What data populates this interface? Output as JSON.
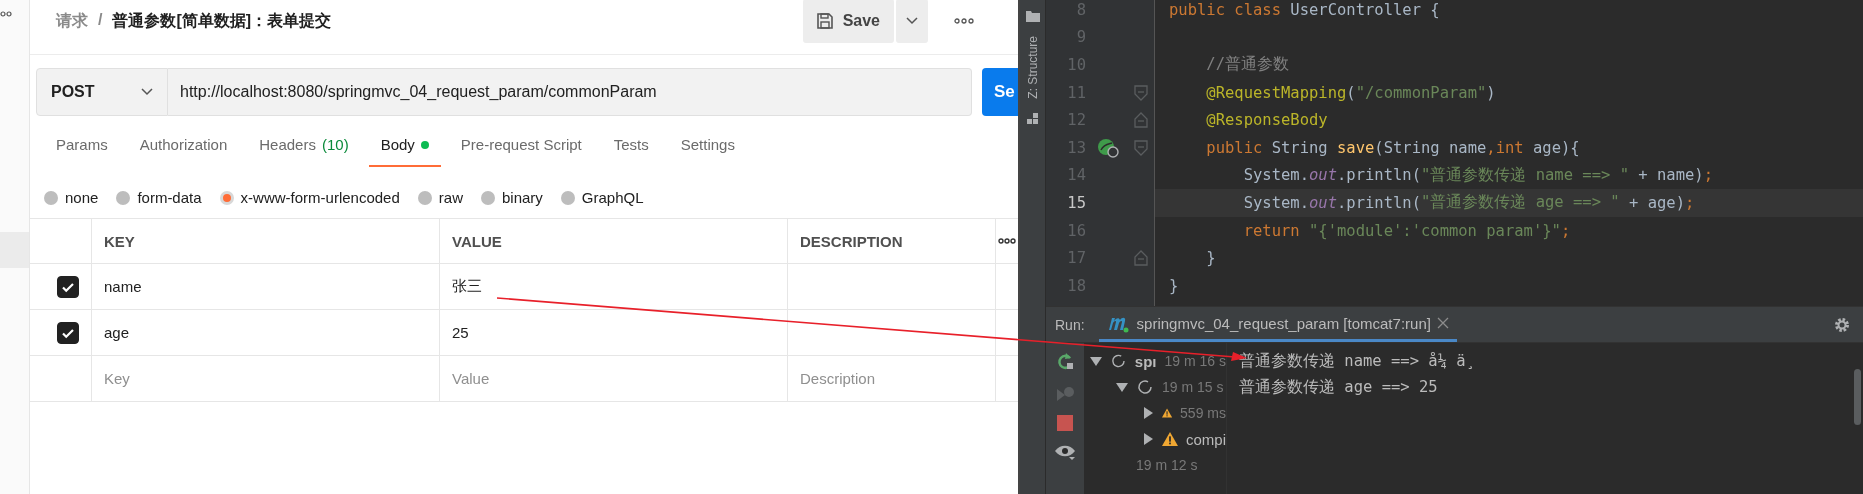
{
  "postman": {
    "breadcrumb": {
      "parent": "请求",
      "separator": "/",
      "title": "普通参数[简单数据]：表单提交"
    },
    "save_button": "Save",
    "request": {
      "method": "POST",
      "url": "http://localhost:8080/springmvc_04_request_param/commonParam",
      "send": "Se"
    },
    "tabs": [
      {
        "label": "Params",
        "selected": false
      },
      {
        "label": "Authorization",
        "selected": false
      },
      {
        "label": "Headers",
        "count": "(10)",
        "selected": false
      },
      {
        "label": "Body",
        "dot": true,
        "selected": true
      },
      {
        "label": "Pre-request Script",
        "selected": false
      },
      {
        "label": "Tests",
        "selected": false
      },
      {
        "label": "Settings",
        "selected": false
      }
    ],
    "body_types": [
      {
        "label": "none",
        "selected": false
      },
      {
        "label": "form-data",
        "selected": false
      },
      {
        "label": "x-www-form-urlencoded",
        "selected": true
      },
      {
        "label": "raw",
        "selected": false
      },
      {
        "label": "binary",
        "selected": false
      },
      {
        "label": "GraphQL",
        "selected": false
      }
    ],
    "table": {
      "columns": [
        "KEY",
        "VALUE",
        "DESCRIPTION"
      ],
      "rows": [
        {
          "checked": true,
          "key": "name",
          "value": "张三"
        },
        {
          "checked": true,
          "key": "age",
          "value": "25"
        }
      ],
      "new_row": [
        {
          "placeholder": "Key"
        },
        {
          "placeholder": "Value"
        },
        {
          "placeholder": "Description"
        }
      ]
    }
  },
  "ide": {
    "structure_label": "Z: Structure",
    "lines": [
      {
        "number": "8",
        "kind": "plain",
        "current": false,
        "tokens": [
          {
            "kind": "keyword",
            "text": "public class "
          },
          {
            "kind": "plain",
            "text": "UserController {"
          }
        ]
      },
      {
        "number": "9",
        "kind": "plain",
        "current": false
      },
      {
        "number": "10",
        "kind": "plain",
        "current": false,
        "tokens": [
          {
            "kind": "comment",
            "text": "    //普通参数"
          }
        ]
      },
      {
        "number": "11",
        "kind": "fold-start",
        "current": false,
        "tokens": [
          {
            "kind": "annotation",
            "text": "    @RequestMapping"
          },
          {
            "kind": "plain",
            "text": "("
          },
          {
            "kind": "string",
            "text": "\"/commonParam\""
          },
          {
            "kind": "plain",
            "text": ")"
          }
        ]
      },
      {
        "number": "12",
        "kind": "fold-end",
        "current": false,
        "tokens": [
          {
            "kind": "annotation",
            "text": "    @ResponseBody"
          }
        ]
      },
      {
        "number": "13",
        "kind": "method",
        "current": false,
        "tokens": [
          {
            "kind": "keyword",
            "text": "    public "
          },
          {
            "kind": "plain",
            "text": "String "
          },
          {
            "kind": "method",
            "text": "save"
          },
          {
            "kind": "plain",
            "text": "(String name"
          },
          {
            "kind": "keyword",
            "text": ","
          },
          {
            "kind": "keyword",
            "text": "int "
          },
          {
            "kind": "plain",
            "text": "age){"
          }
        ]
      },
      {
        "number": "14",
        "kind": "plain",
        "current": false,
        "tokens": [
          {
            "kind": "plain",
            "text": "        System."
          },
          {
            "kind": "field",
            "text": "out"
          },
          {
            "kind": "plain",
            "text": ".println("
          },
          {
            "kind": "string",
            "text": "\"普通参数传递 name ==> \""
          },
          {
            "kind": "plain",
            "text": " + name)"
          },
          {
            "kind": "keyword",
            "text": ";"
          }
        ]
      },
      {
        "number": "15",
        "kind": "plain",
        "current": true,
        "tokens": [
          {
            "kind": "plain",
            "text": "        System."
          },
          {
            "kind": "field",
            "text": "out"
          },
          {
            "kind": "plain",
            "text": ".println("
          },
          {
            "kind": "string",
            "text": "\"普通参数传递 age ==> \""
          },
          {
            "kind": "plain",
            "text": " + age)"
          },
          {
            "kind": "keyword",
            "text": ";"
          }
        ]
      },
      {
        "number": "16",
        "kind": "plain",
        "current": false,
        "tokens": [
          {
            "kind": "keyword",
            "text": "        return "
          },
          {
            "kind": "string",
            "text": "\"{'module':'common param'}\""
          },
          {
            "kind": "keyword",
            "text": ";"
          }
        ]
      },
      {
        "number": "17",
        "kind": "fold-end",
        "current": false,
        "tokens": [
          {
            "kind": "plain",
            "text": "    }"
          }
        ]
      },
      {
        "number": "18",
        "kind": "plain",
        "current": false,
        "tokens": [
          {
            "kind": "plain",
            "text": "}"
          }
        ]
      }
    ],
    "run": {
      "label": "Run:",
      "tab": "springmvc_04_request_param [tomcat7:run]",
      "tree": [
        {
          "label": "spı",
          "time": "19 m 16 s",
          "expanded": true,
          "children": [
            {
              "time": "19 m 15 s",
              "expanded": true,
              "children": [
                {
                  "time": "559 ms",
                  "warning": true,
                  "expanded": false
                },
                {
                  "label": "compi",
                  "warning": true,
                  "expanded": false
                }
              ]
            },
            {
              "time": "19 m 12 s"
            }
          ]
        }
      ],
      "output": [
        "普通参数传递 name ==> å¼ ä¸",
        "普通参数传递 age ==> 25"
      ]
    }
  }
}
